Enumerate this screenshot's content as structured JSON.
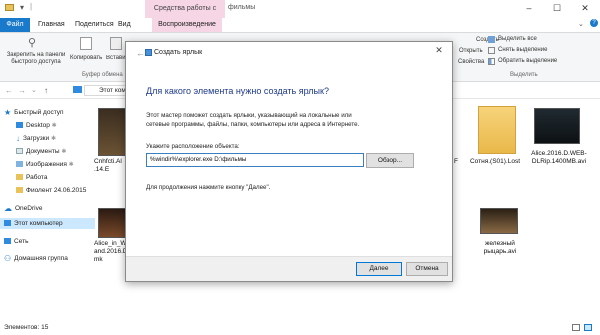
{
  "window": {
    "title": "фильмы",
    "context_tab": "Средства работы с видео",
    "context_tab_sub": "Воспроизведение"
  },
  "ribbon": {
    "tabs": [
      "Файл",
      "Главная",
      "Поделиться",
      "Вид"
    ],
    "pin_label": "Закрепить на панели быстрого доступа",
    "copy_label": "Копировать",
    "paste_label": "Вставить",
    "clipboard_group": "Буфер обмена",
    "select_all": "Выделить все",
    "remove_selection": "Снять выделение",
    "invert_selection": "Обратить выделение",
    "select_group": "Выделить",
    "create": "Создать",
    "open": "Открыть",
    "properties": "Свойства"
  },
  "address": {
    "path": "Этот компьютер"
  },
  "nav": {
    "items": [
      {
        "label": "Быстрый доступ"
      },
      {
        "label": "Desktop"
      },
      {
        "label": "Загрузки"
      },
      {
        "label": "Документы"
      },
      {
        "label": "Изображения"
      },
      {
        "label": "Работа"
      },
      {
        "label": "Фиолент 24.06.2015"
      },
      {
        "label": "OneDrive"
      },
      {
        "label": "Этот компьютер"
      },
      {
        "label": "Сеть"
      },
      {
        "label": "Домашняя группа"
      }
    ]
  },
  "files": {
    "row1": [
      {
        "label": "Cnhfcti.Al .14.E"
      },
      {
        "label": "F"
      },
      {
        "label": "Сотня.(S01).Lost"
      },
      {
        "label": "Alice.2016.D.WEB-DLRip.1400MB.avi"
      }
    ],
    "row2": [
      {
        "label": "Alice_in_W and.2016.D mk"
      },
      {
        "label": "железный рыцарь.avi"
      }
    ]
  },
  "status": {
    "items_count": "Элементов: 15"
  },
  "dialog": {
    "title": "Создать ярлык",
    "heading": "Для какого элемента нужно создать ярлык?",
    "description": "Этот мастер поможет создать ярлыки, указывающий на локальные или сетевые программы, файлы, папки, компьютеры или адреса в Интернете.",
    "location_label": "Укажите расположение объекта:",
    "location_value": "%windir%\\explorer.exe D:\\фильмы",
    "browse_button": "Обзор...",
    "next_hint": "Для продолжения нажмите кнопку \"Далее\".",
    "next_button": "Далее",
    "cancel_button": "Отмена"
  },
  "colors": {
    "accent": "#1979ca",
    "context_tab": "#f6d5e4",
    "heading": "#1e3a8a"
  }
}
